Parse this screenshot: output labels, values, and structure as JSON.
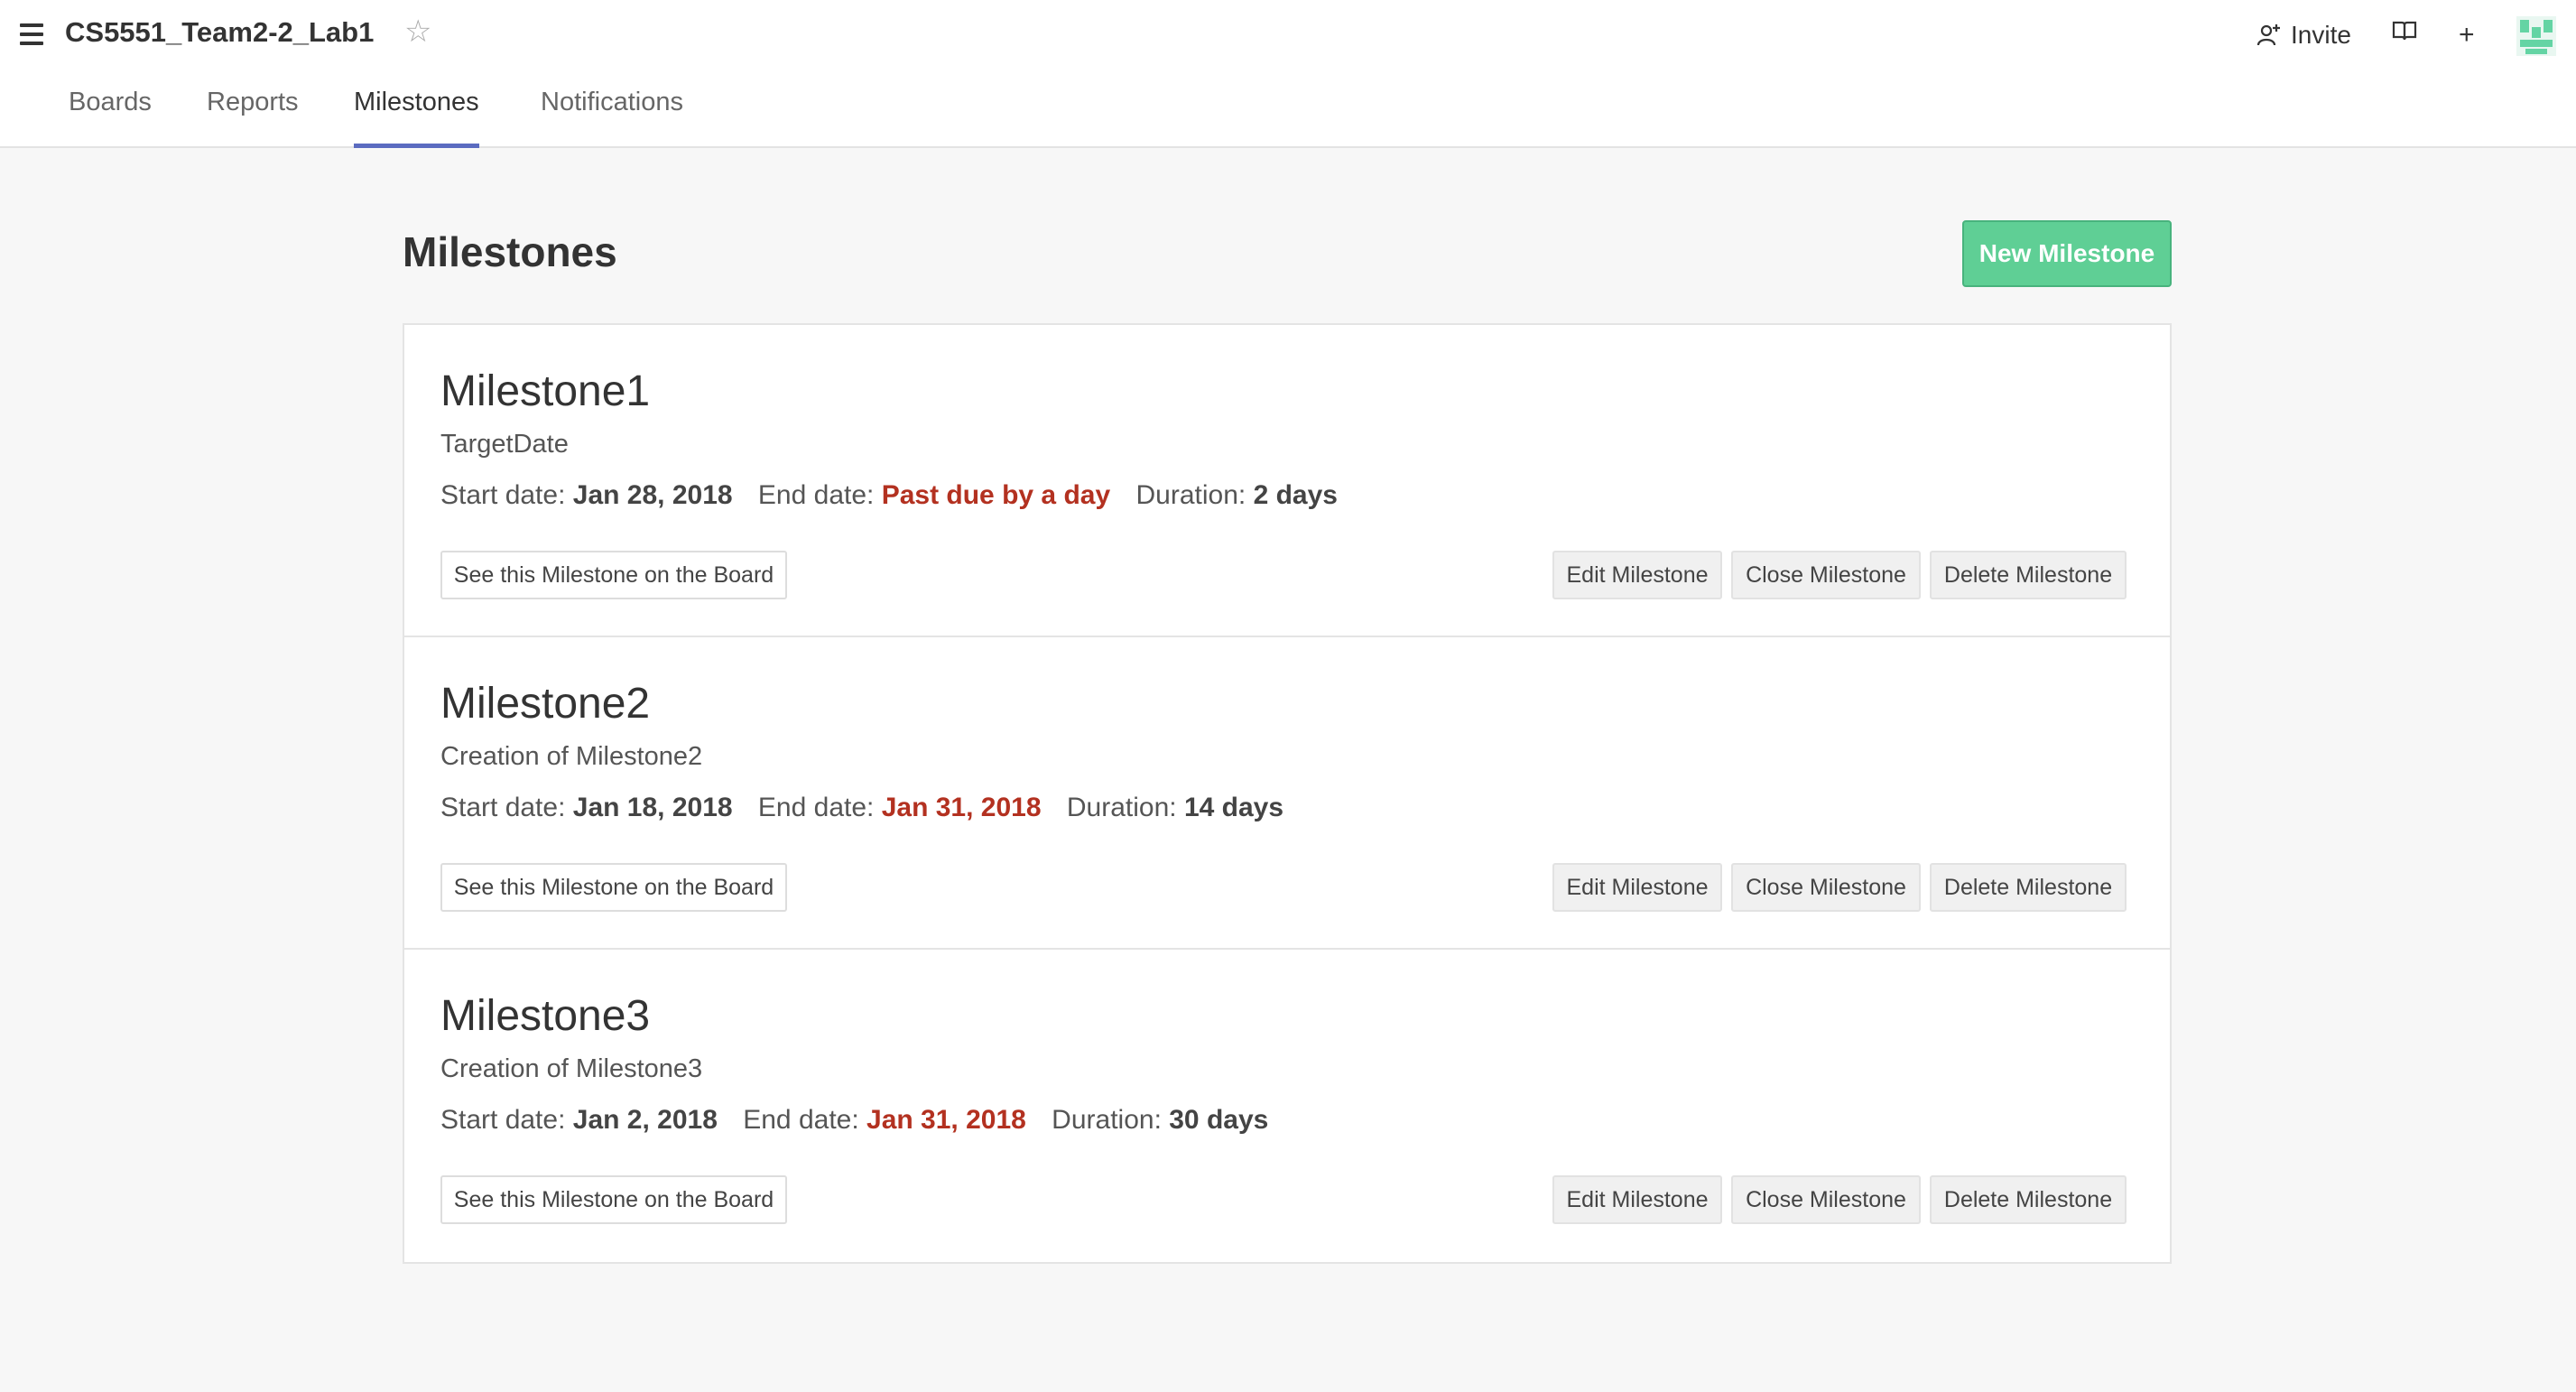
{
  "header": {
    "repo_title": "CS5551_Team2-2_Lab1",
    "star_icon": "star-icon",
    "invite_label": "Invite",
    "invite_icon": "add-person-icon",
    "book_icon": "book-icon",
    "plus_label": "+",
    "avatar_icon": "avatar-identicon"
  },
  "tabs": [
    {
      "label": "Boards",
      "active": false
    },
    {
      "label": "Reports",
      "active": false
    },
    {
      "label": "Milestones",
      "active": true
    },
    {
      "label": "Notifications",
      "active": false
    }
  ],
  "page": {
    "title": "Milestones",
    "new_button": "New Milestone"
  },
  "labels": {
    "start": "Start date:",
    "end": "End date:",
    "duration": "Duration:",
    "see_board": "See this Milestone on the Board",
    "edit": "Edit Milestone",
    "close": "Close Milestone",
    "delete": "Delete Milestone"
  },
  "milestones": [
    {
      "title": "Milestone1",
      "description": "TargetDate",
      "start_date": "Jan 28, 2018",
      "end_date": "Past due by a day",
      "duration": "2 days"
    },
    {
      "title": "Milestone2",
      "description": "Creation of Milestone2",
      "start_date": "Jan 18, 2018",
      "end_date": "Jan 31, 2018",
      "duration": "14 days"
    },
    {
      "title": "Milestone3",
      "description": "Creation of Milestone3",
      "start_date": "Jan 2, 2018",
      "end_date": "Jan 31, 2018",
      "duration": "30 days"
    }
  ],
  "colors": {
    "accent": "#5b6bc0",
    "primary_button": "#5fcf95",
    "due_text": "#b33120"
  }
}
